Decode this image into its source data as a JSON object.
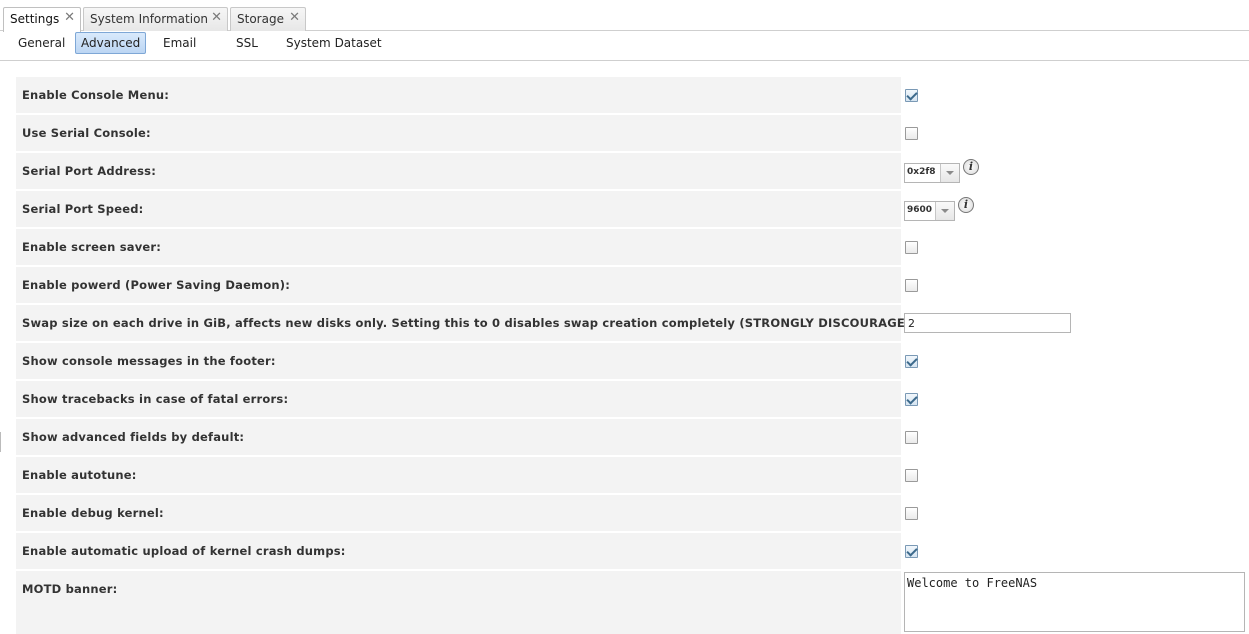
{
  "tabs": [
    {
      "label": "Settings",
      "active": true
    },
    {
      "label": "System Information",
      "active": false
    },
    {
      "label": "Storage",
      "active": false
    }
  ],
  "subtabs": [
    {
      "label": "General",
      "active": false
    },
    {
      "label": "Advanced",
      "active": true
    },
    {
      "label": "Email",
      "active": false
    },
    {
      "label": "SSL",
      "active": false
    },
    {
      "label": "System Dataset",
      "active": false
    }
  ],
  "form": {
    "enable_console_menu": {
      "label": "Enable Console Menu:",
      "checked": true
    },
    "use_serial_console": {
      "label": "Use Serial Console:",
      "checked": false
    },
    "serial_port_address": {
      "label": "Serial Port Address:",
      "value": "0x2f8"
    },
    "serial_port_speed": {
      "label": "Serial Port Speed:",
      "value": "9600"
    },
    "enable_screen_saver": {
      "label": "Enable screen saver:",
      "checked": false
    },
    "enable_powerd": {
      "label": "Enable powerd (Power Saving Daemon):",
      "checked": false
    },
    "swap_size": {
      "label": "Swap size on each drive in GiB, affects new disks only. Setting this to 0 disables swap creation completely (STRONGLY DISCOURAGED).",
      "value": "2"
    },
    "show_console_messages": {
      "label": "Show console messages in the footer:",
      "checked": true
    },
    "show_tracebacks": {
      "label": "Show tracebacks in case of fatal errors:",
      "checked": true
    },
    "show_advanced_fields": {
      "label": "Show advanced fields by default:",
      "checked": false
    },
    "enable_autotune": {
      "label": "Enable autotune:",
      "checked": false
    },
    "enable_debug_kernel": {
      "label": "Enable debug kernel:",
      "checked": false
    },
    "enable_crash_dumps": {
      "label": "Enable automatic upload of kernel crash dumps:",
      "checked": true
    },
    "motd_banner": {
      "label": "MOTD banner:",
      "value": "Welcome to FreeNAS"
    }
  },
  "icons": {
    "close": "close-icon",
    "info": "info-icon",
    "dropdown": "chevron-down-icon"
  },
  "colors": {
    "active_subtab": "#bcd6f3",
    "row_background": "#f3f3f3",
    "check": "#3d6a8c"
  }
}
